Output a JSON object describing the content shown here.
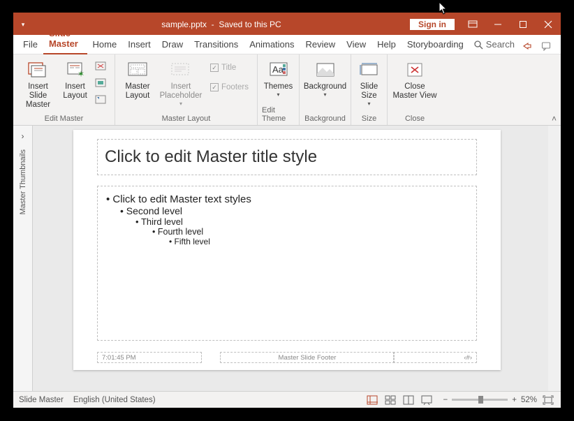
{
  "titlebar": {
    "filename": "sample.pptx",
    "status": "Saved to this PC",
    "signin": "Sign in"
  },
  "menu": {
    "file": "File",
    "slide_master": "Slide Master",
    "home": "Home",
    "insert": "Insert",
    "draw": "Draw",
    "transitions": "Transitions",
    "animations": "Animations",
    "review": "Review",
    "view": "View",
    "help": "Help",
    "storyboarding": "Storyboarding",
    "search": "Search"
  },
  "ribbon": {
    "edit_master": {
      "label": "Edit Master",
      "insert_slide_master": "Insert Slide\nMaster",
      "insert_layout": "Insert\nLayout"
    },
    "master_layout": {
      "label": "Master Layout",
      "master_layout_btn": "Master\nLayout",
      "insert_placeholder": "Insert\nPlaceholder",
      "title_chk": "Title",
      "footers_chk": "Footers"
    },
    "edit_theme": {
      "label": "Edit Theme",
      "themes": "Themes"
    },
    "background": {
      "label": "Background",
      "background_btn": "Background"
    },
    "size": {
      "label": "Size",
      "slide_size": "Slide\nSize"
    },
    "close": {
      "label": "Close",
      "close_master": "Close\nMaster View"
    }
  },
  "thumbnails": {
    "label": "Master Thumbnails"
  },
  "slide": {
    "title_ph": "Click to edit Master title style",
    "body": {
      "l1": "Click to edit Master text styles",
      "l2": "Second level",
      "l3": "Third level",
      "l4": "Fourth level",
      "l5": "Fifth level"
    },
    "date": "7:01:45 PM",
    "footer": "Master Slide Footer",
    "number": "‹#›"
  },
  "status": {
    "view": "Slide Master",
    "lang": "English (United States)",
    "zoom": "52%"
  }
}
